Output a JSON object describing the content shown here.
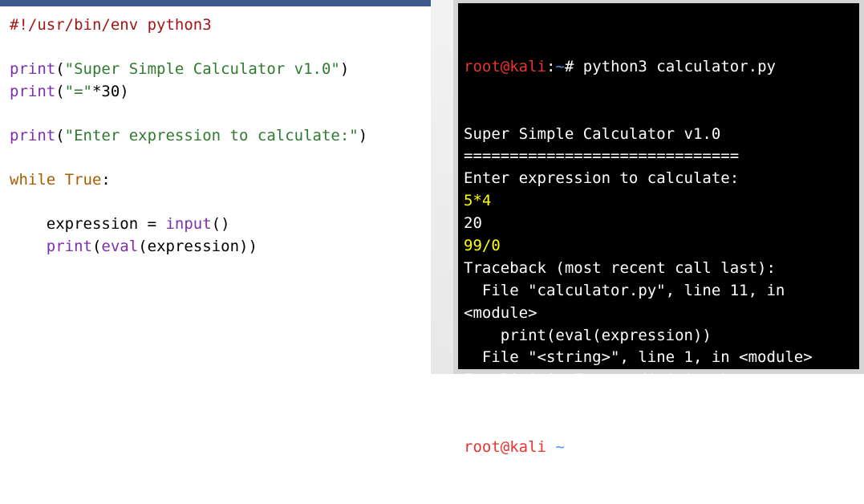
{
  "editor": {
    "lines": [
      [
        {
          "t": "#!/usr/bin/env python3",
          "c": "comment"
        }
      ],
      [],
      [
        {
          "t": "print",
          "c": "builtin"
        },
        {
          "t": "(",
          "c": "plain"
        },
        {
          "t": "\"Super Simple Calculator v1.0\"",
          "c": "string"
        },
        {
          "t": ")",
          "c": "plain"
        }
      ],
      [
        {
          "t": "print",
          "c": "builtin"
        },
        {
          "t": "(",
          "c": "plain"
        },
        {
          "t": "\"=\"",
          "c": "string"
        },
        {
          "t": "*30)",
          "c": "plain"
        }
      ],
      [],
      [
        {
          "t": "print",
          "c": "builtin"
        },
        {
          "t": "(",
          "c": "plain"
        },
        {
          "t": "\"Enter expression to calculate:\"",
          "c": "string"
        },
        {
          "t": ")",
          "c": "plain"
        }
      ],
      [],
      [
        {
          "t": "while",
          "c": "keyword"
        },
        {
          "t": " ",
          "c": "plain"
        },
        {
          "t": "True",
          "c": "keyword"
        },
        {
          "t": ":",
          "c": "plain"
        }
      ],
      [],
      [
        {
          "t": "    expression = ",
          "c": "plain"
        },
        {
          "t": "input",
          "c": "builtin"
        },
        {
          "t": "()",
          "c": "plain"
        }
      ],
      [
        {
          "t": "    ",
          "c": "plain"
        },
        {
          "t": "print",
          "c": "builtin"
        },
        {
          "t": "(",
          "c": "plain"
        },
        {
          "t": "eval",
          "c": "builtin"
        },
        {
          "t": "(expression))",
          "c": "plain"
        }
      ]
    ]
  },
  "terminal": {
    "prompt_user": "root@kali",
    "prompt_sep": ":",
    "prompt_path": "~",
    "prompt_symbol": "#",
    "command": " python3 calculator.py",
    "output_lines": [
      {
        "t": "Super Simple Calculator v1.0",
        "c": "white"
      },
      {
        "t": "==============================",
        "c": "white"
      },
      {
        "t": "Enter expression to calculate:",
        "c": "white"
      },
      {
        "t": "5*4",
        "c": "yellow"
      },
      {
        "t": "20",
        "c": "white"
      },
      {
        "t": "99/0",
        "c": "yellow"
      },
      {
        "t": "Traceback (most recent call last):",
        "c": "white"
      },
      {
        "t": "  File \"calculator.py\", line 11, in",
        "c": "white"
      },
      {
        "t": "<module>",
        "c": "white"
      },
      {
        "t": "    print(eval(expression))",
        "c": "white"
      },
      {
        "t": "  File \"<string>\", line 1, in <module>",
        "c": "white"
      },
      {
        "t": "ZeroDivisionError: division by zero",
        "c": "white"
      }
    ]
  },
  "colors": {
    "editor_accent_bar": "#3c5a8c",
    "terminal_bg": "#000000",
    "prompt_user": "#e8332f",
    "prompt_path": "#4f8ff7",
    "user_input": "#ffff00",
    "code_string": "#2f7a2f",
    "code_builtin": "#7b2fb0",
    "code_keyword": "#a85c00",
    "code_comment": "#a31515"
  }
}
